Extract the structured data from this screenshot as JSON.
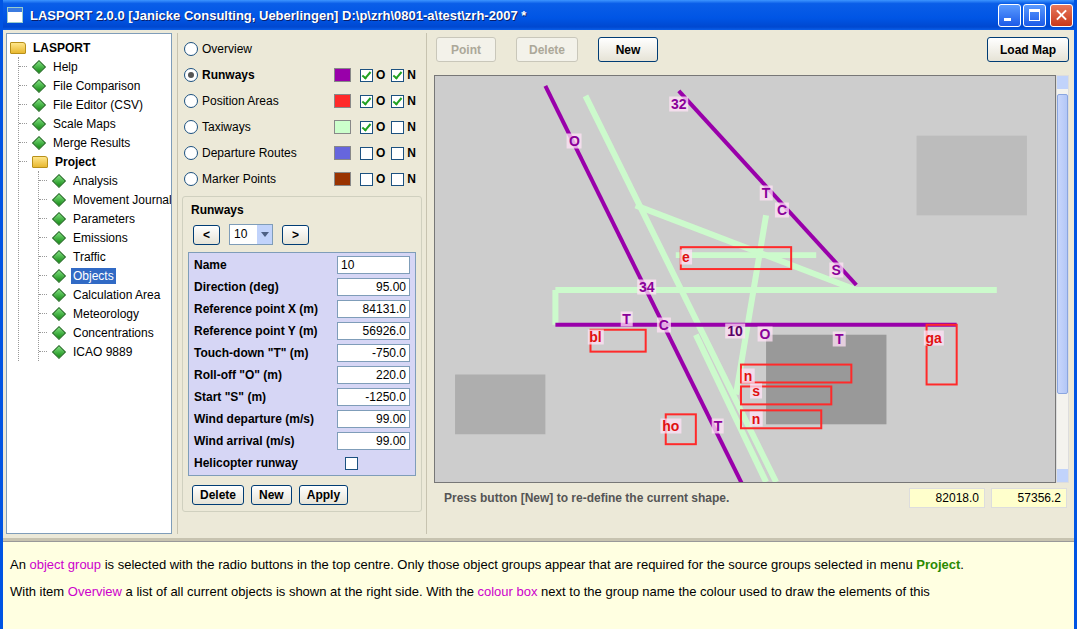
{
  "window": {
    "title": "LASPORT 2.0.0 [Janicke Consulting, Ueberlingen] D:\\p\\zrh\\0801-a\\test\\zrh-2007 *"
  },
  "tree": {
    "label": "LASPORT",
    "kind": "folder",
    "expanded": true,
    "selected": false,
    "children": [
      {
        "label": "Help",
        "kind": "leaf",
        "selected": false
      },
      {
        "label": "File Comparison",
        "kind": "leaf",
        "selected": false
      },
      {
        "label": "File Editor (CSV)",
        "kind": "leaf",
        "selected": false
      },
      {
        "label": "Scale Maps",
        "kind": "leaf",
        "selected": false
      },
      {
        "label": "Merge Results",
        "kind": "leaf",
        "selected": false
      },
      {
        "label": "Project",
        "kind": "folder",
        "expanded": true,
        "selected": false,
        "children": [
          {
            "label": "Analysis",
            "kind": "leaf",
            "selected": false
          },
          {
            "label": "Movement Journal",
            "kind": "leaf",
            "selected": false
          },
          {
            "label": "Parameters",
            "kind": "leaf",
            "selected": false
          },
          {
            "label": "Emissions",
            "kind": "leaf",
            "selected": false
          },
          {
            "label": "Traffic",
            "kind": "leaf",
            "selected": false
          },
          {
            "label": "Objects",
            "kind": "leaf",
            "selected": true
          },
          {
            "label": "Calculation Area",
            "kind": "leaf",
            "selected": false
          },
          {
            "label": "Meteorology",
            "kind": "leaf",
            "selected": false
          },
          {
            "label": "Concentrations",
            "kind": "leaf",
            "selected": false
          },
          {
            "label": "ICAO 9889",
            "kind": "leaf",
            "selected": false
          }
        ]
      }
    ]
  },
  "groups": [
    {
      "label": "Overview",
      "selected": false,
      "kind": "plain"
    },
    {
      "label": "Runways",
      "selected": true,
      "kind": "layer",
      "color": "#9900aa",
      "checks": [
        {
          "label": "O",
          "checked": true
        },
        {
          "label": "N",
          "checked": true
        }
      ]
    },
    {
      "label": "Position Areas",
      "selected": false,
      "kind": "layer",
      "color": "#ff2a2a",
      "checks": [
        {
          "label": "O",
          "checked": true
        },
        {
          "label": "N",
          "checked": true
        }
      ]
    },
    {
      "label": "Taxiways",
      "selected": false,
      "kind": "layer",
      "color": "#ccffcc",
      "checks": [
        {
          "label": "O",
          "checked": true
        },
        {
          "label": "N",
          "checked": false
        }
      ]
    },
    {
      "label": "Departure Routes",
      "selected": false,
      "kind": "layer",
      "color": "#6666dd",
      "checks": [
        {
          "label": "O",
          "checked": false
        },
        {
          "label": "N",
          "checked": false
        }
      ]
    },
    {
      "label": "Marker Points",
      "selected": false,
      "kind": "layer",
      "color": "#993300",
      "checks": [
        {
          "label": "O",
          "checked": false
        },
        {
          "label": "N",
          "checked": false
        }
      ]
    }
  ],
  "editor": {
    "title": "Runways",
    "prev": "<",
    "next": ">",
    "current": "10",
    "fields": [
      {
        "label": "Name",
        "kind": "text",
        "value": "10"
      },
      {
        "label": "Direction (deg)",
        "kind": "number",
        "value": "95.00"
      },
      {
        "label": "Reference point X (m)",
        "kind": "number",
        "value": "84131.0"
      },
      {
        "label": "Reference point Y (m)",
        "kind": "number",
        "value": "56926.0"
      },
      {
        "label": "Touch-down \"T\" (m)",
        "kind": "number",
        "value": "-750.0"
      },
      {
        "label": "Roll-off \"O\" (m)",
        "kind": "number",
        "value": "220.0"
      },
      {
        "label": "Start \"S\" (m)",
        "kind": "number",
        "value": "-1250.0"
      },
      {
        "label": "Wind departure (m/s)",
        "kind": "number",
        "value": "99.00"
      },
      {
        "label": "Wind arrival (m/s)",
        "kind": "number",
        "value": "99.00"
      },
      {
        "label": "Helicopter runway",
        "kind": "checkbox",
        "checked": false
      }
    ],
    "buttons": [
      "Delete",
      "New",
      "Apply"
    ]
  },
  "toolbar": {
    "buttons": [
      {
        "label": "Point",
        "disabled": true
      },
      {
        "label": "Delete",
        "disabled": true
      },
      {
        "label": "New",
        "disabled": false
      }
    ],
    "load": {
      "label": "Load Map",
      "disabled": false
    }
  },
  "map": {
    "labels": [
      {
        "text": "32",
        "color": "#8a0099"
      },
      {
        "text": "O",
        "color": "#8a0099"
      },
      {
        "text": "T",
        "color": "#8a0099"
      },
      {
        "text": "C",
        "color": "#8a0099"
      },
      {
        "text": "S",
        "color": "#8a0099"
      },
      {
        "text": "e",
        "color": "#e01010"
      },
      {
        "text": "34",
        "color": "#8a0099"
      },
      {
        "text": "T",
        "color": "#8a0099"
      },
      {
        "text": "C",
        "color": "#8a0099"
      },
      {
        "text": "10",
        "color": "#5a0066"
      },
      {
        "text": "O",
        "color": "#8a0099"
      },
      {
        "text": "T",
        "color": "#8a0099"
      },
      {
        "text": "ga",
        "color": "#e01010"
      },
      {
        "text": "bl",
        "color": "#e01010"
      },
      {
        "text": "n",
        "color": "#e01010"
      },
      {
        "text": "s",
        "color": "#e01010"
      },
      {
        "text": "n",
        "color": "#e01010"
      },
      {
        "text": "ho",
        "color": "#e01010"
      },
      {
        "text": "T",
        "color": "#8a0099"
      }
    ]
  },
  "status": {
    "message": "Press button [New] to re-define the current shape.",
    "x": "82018.0",
    "y": "57356.2"
  },
  "help": {
    "paragraphs": [
      [
        {
          "text": "An ",
          "kind": "plain"
        },
        {
          "text": "object group",
          "kind": "link"
        },
        {
          "text": " is selected with the radio buttons in the top centre. Only those object groups appear that are required for the source groups selected in menu ",
          "kind": "plain"
        },
        {
          "text": "Project",
          "kind": "strong"
        },
        {
          "text": ".",
          "kind": "plain"
        }
      ],
      [
        {
          "text": "With item ",
          "kind": "plain"
        },
        {
          "text": "Overview",
          "kind": "link"
        },
        {
          "text": " a list of all current objects is shown at the right side. With the ",
          "kind": "plain"
        },
        {
          "text": "colour box",
          "kind": "link"
        },
        {
          "text": " next to the group name the colour used to draw the elements of this",
          "kind": "plain"
        }
      ]
    ]
  }
}
